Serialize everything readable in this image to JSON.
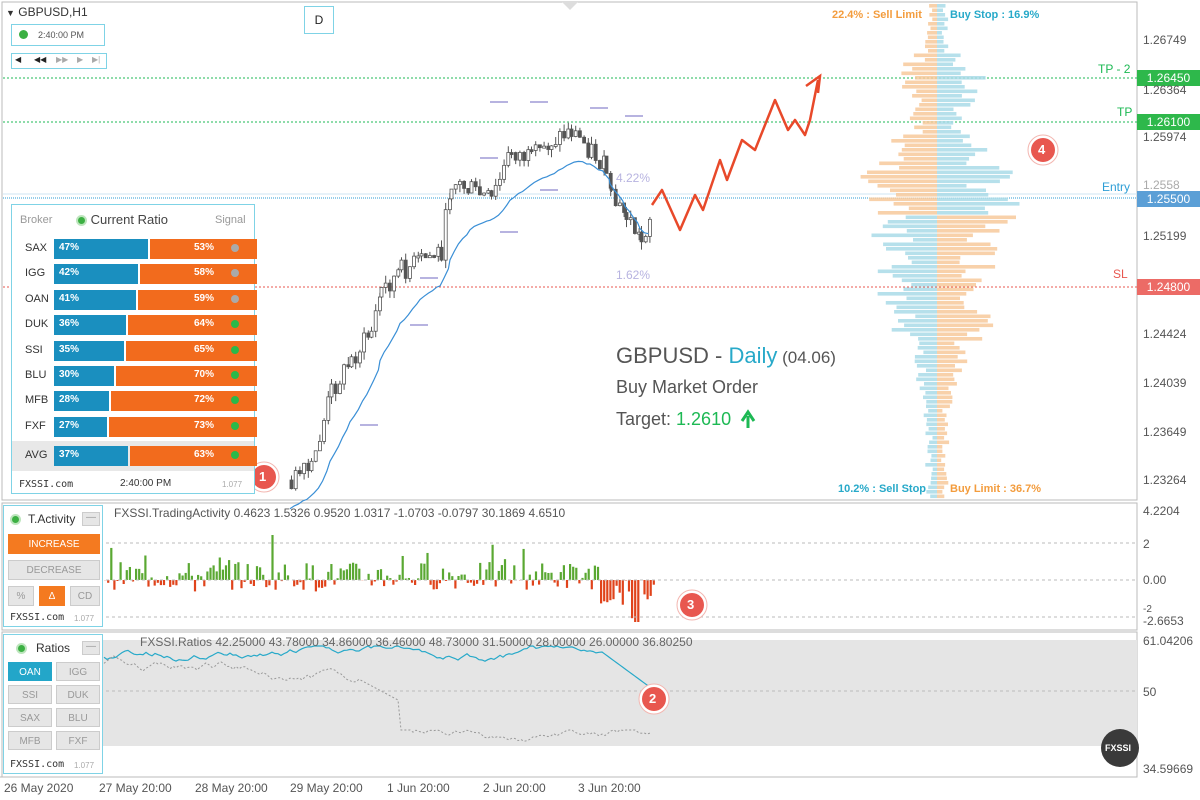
{
  "window": {
    "symbol_title": "GBPUSD,H1",
    "timeframe_button": "D",
    "clock": "2:40:00 PM"
  },
  "levels": [
    {
      "label": "TP - 2",
      "price": "1.26450",
      "color": "#1db954"
    },
    {
      "label": "TP",
      "price": "1.26100",
      "color": "#1db954"
    },
    {
      "label": "Entry",
      "price": "1.25500",
      "color": "#2e9ed6"
    },
    {
      "label": "SL",
      "price": "1.24800",
      "color": "#e8574f"
    }
  ],
  "price_axis": [
    "1.26749",
    "1.26364",
    "1.25974",
    "1.25199",
    "1.24424",
    "1.24039",
    "1.23649",
    "1.23264"
  ],
  "price_axis_partial": "1.2558",
  "date_axis": [
    "26 May 2020",
    "27 May 20:00",
    "28 May 20:00",
    "29 May 20:00",
    "1 Jun 20:00",
    "2 Jun 20:00",
    "3 Jun 20:00"
  ],
  "order_book": {
    "sell_limit": "22.4% : Sell Limit",
    "buy_stop": "Buy Stop : 16.9%",
    "sell_stop": "10.2% : Sell Stop",
    "buy_limit": "Buy Limit : 36.7%"
  },
  "ratio_widget": {
    "title": "Current Ratio",
    "col_broker": "Broker",
    "col_signal": "Signal",
    "rows": [
      {
        "broker": "SAX",
        "buy": "47%",
        "sell": "53%",
        "buy_val": 47,
        "signal": "gray"
      },
      {
        "broker": "IGG",
        "buy": "42%",
        "sell": "58%",
        "buy_val": 42,
        "signal": "gray"
      },
      {
        "broker": "OAN",
        "buy": "41%",
        "sell": "59%",
        "buy_val": 41,
        "signal": "gray"
      },
      {
        "broker": "DUK",
        "buy": "36%",
        "sell": "64%",
        "buy_val": 36,
        "signal": "green"
      },
      {
        "broker": "SSI",
        "buy": "35%",
        "sell": "65%",
        "buy_val": 35,
        "signal": "green"
      },
      {
        "broker": "BLU",
        "buy": "30%",
        "sell": "70%",
        "buy_val": 30,
        "signal": "green"
      },
      {
        "broker": "MFB",
        "buy": "28%",
        "sell": "72%",
        "buy_val": 28,
        "signal": "green"
      },
      {
        "broker": "FXF",
        "buy": "27%",
        "sell": "73%",
        "buy_val": 27,
        "signal": "green"
      }
    ],
    "avg": {
      "broker": "AVG",
      "buy": "37%",
      "sell": "63%",
      "buy_val": 37,
      "signal": "green"
    },
    "footer_site": "FXSSI.com",
    "footer_time": "2:40:00 PM",
    "footer_version": "1.077"
  },
  "headline": {
    "pair": "GBPUSD - ",
    "period": "Daily",
    "date": " (04.06)",
    "order": "Buy Market Order",
    "target_label": "Target: ",
    "target_value": "1.2610"
  },
  "pct_labels": {
    "upper": "4.22%",
    "lower": "1.62%"
  },
  "markers": [
    "1",
    "2",
    "3",
    "4"
  ],
  "activity_panel": {
    "title": "T.Activity",
    "increase": "INCREASE",
    "decrease": "DECREASE",
    "btn_pct": "%",
    "btn_delta": "Δ",
    "btn_cd": "CD",
    "site": "FXSSI.com",
    "version": "1.077",
    "indicator_line": "FXSSI.TradingActivity 0.4623 1.5326 0.9520 1.0317 -1.0703 -0.0797 30.1869 4.6510",
    "axis": [
      "4.2204",
      "2",
      "0.00",
      "-2",
      "-2.6653"
    ]
  },
  "ratios_panel": {
    "title": "Ratios",
    "buttons": [
      "OAN",
      "IGG",
      "SSI",
      "DUK",
      "SAX",
      "BLU",
      "MFB",
      "FXF"
    ],
    "site": "FXSSI.com",
    "version": "1.077",
    "indicator_line": "FXSSI.Ratios 42.25000 43.78000 34.86000 36.46000 48.73000 31.50000 28.00000 26.00000 36.80250",
    "axis": [
      "61.04206",
      "50",
      "34.59669"
    ]
  },
  "logo": "FXSSI",
  "colors": {
    "buy": "#1a8fbf",
    "sell": "#f26b1d",
    "green": "#5aa832",
    "red": "#e0431b",
    "forecast": "#e8492a",
    "ma": "#3a8fd6"
  }
}
